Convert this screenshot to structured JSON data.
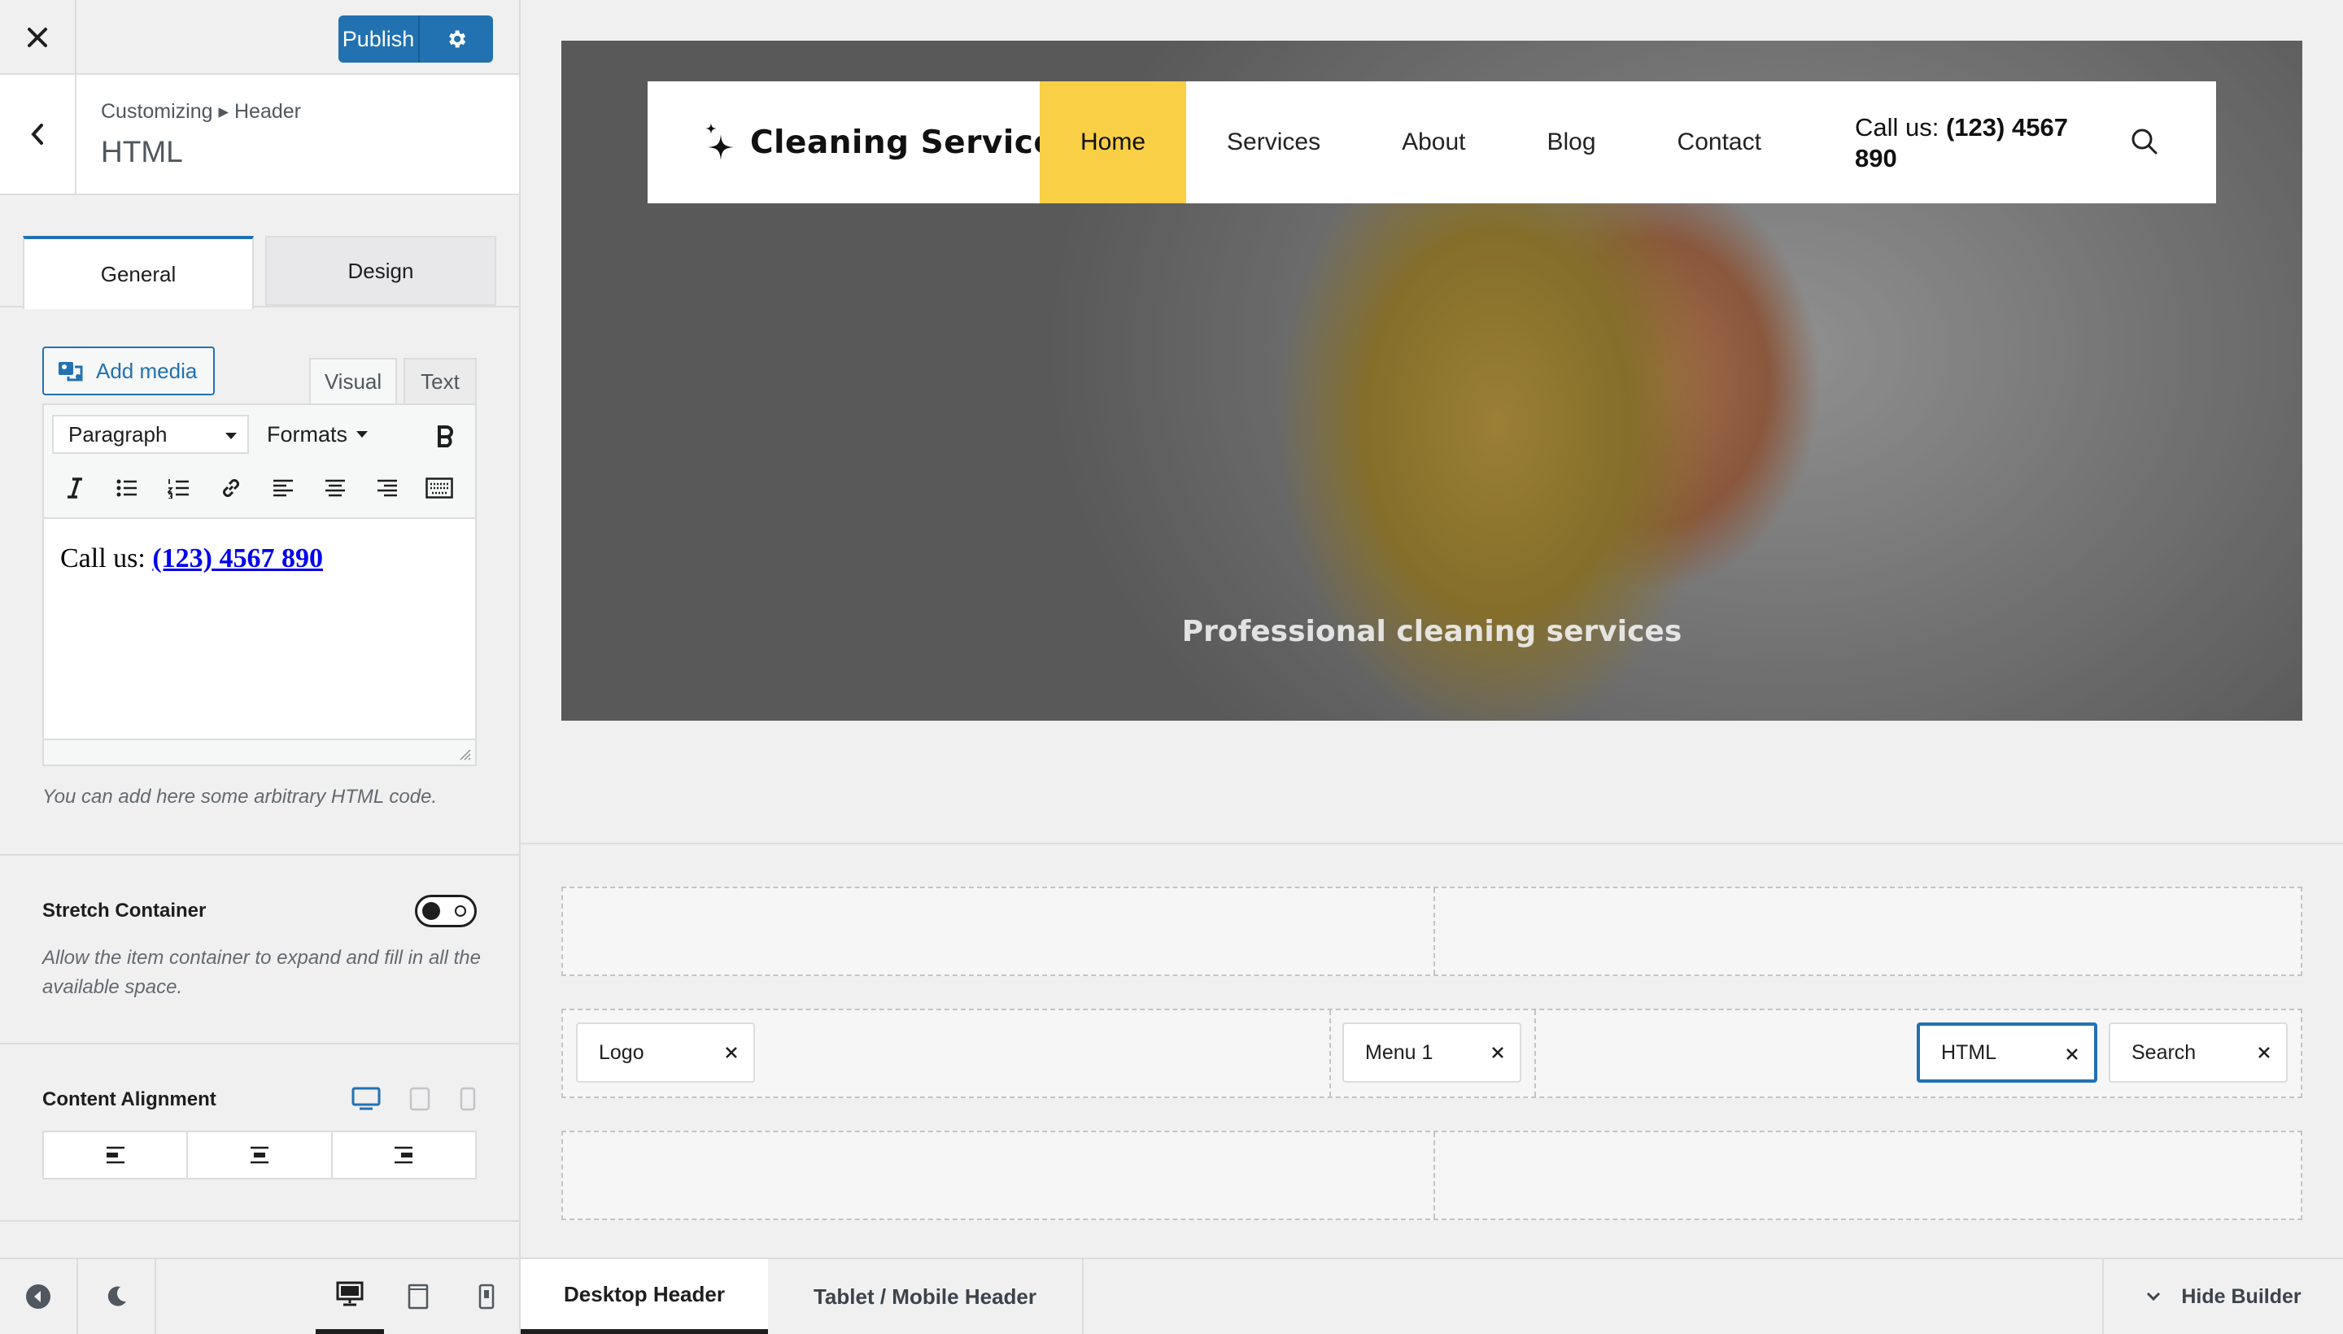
{
  "topbar": {
    "publish_label": "Publish"
  },
  "section": {
    "breadcrumb": "Customizing ▸ Header",
    "title": "HTML"
  },
  "tabs": [
    {
      "label": "General"
    },
    {
      "label": "Design"
    }
  ],
  "editor": {
    "add_media_label": "Add media",
    "tab_visual": "Visual",
    "tab_text": "Text",
    "block_format": "Paragraph",
    "formats_label": "Formats",
    "content_prefix": "Call us: ",
    "content_link": "(123) 4567 890",
    "help": "You can add here some arbitrary HTML code."
  },
  "stretch": {
    "label": "Stretch Container",
    "enabled": false,
    "help": "Allow the item container to expand and fill in all the available space."
  },
  "alignment": {
    "label": "Content Alignment",
    "options": [
      "left",
      "center",
      "right"
    ]
  },
  "preview": {
    "site_title": "Cleaning Service",
    "nav": [
      {
        "label": "Home",
        "active": true
      },
      {
        "label": "Services",
        "active": false
      },
      {
        "label": "About",
        "active": false
      },
      {
        "label": "Blog",
        "active": false
      },
      {
        "label": "Contact",
        "active": false
      }
    ],
    "call_prefix": "Call us: ",
    "call_number": "(123) 4567 890",
    "tagline": "Professional cleaning services",
    "accent_color": "#f8cf45"
  },
  "builder": {
    "items": [
      {
        "label": "Logo"
      },
      {
        "label": "Menu 1"
      },
      {
        "label": "HTML",
        "selected": true
      },
      {
        "label": "Search"
      }
    ]
  },
  "footer": {
    "tab_desktop": "Desktop Header",
    "tab_tablet": "Tablet / Mobile Header",
    "hide_builder": "Hide Builder"
  },
  "colors": {
    "primary": "#2271b1",
    "accent": "#f8cf45"
  }
}
